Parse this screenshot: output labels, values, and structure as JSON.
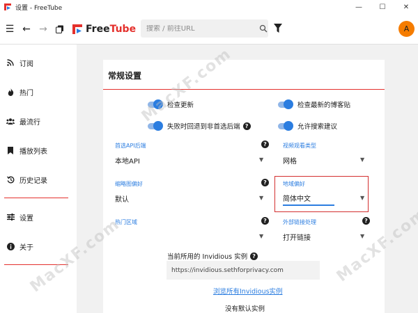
{
  "window": {
    "title": "设置 - FreeTube",
    "minimize": "—",
    "maximize": "☐",
    "close": "✕"
  },
  "topnav": {
    "brand_free": "Free",
    "brand_tube": "Tube",
    "search_placeholder": "搜索 / 前往URL",
    "avatar_letter": "A"
  },
  "sidebar": {
    "items": [
      {
        "label": "订阅",
        "icon": "rss-icon"
      },
      {
        "label": "热门",
        "icon": "fire-icon"
      },
      {
        "label": "最流行",
        "icon": "users-icon"
      },
      {
        "label": "播放列表",
        "icon": "bookmark-icon"
      },
      {
        "label": "历史记录",
        "icon": "history-icon"
      },
      {
        "label": "设置",
        "icon": "sliders-icon"
      },
      {
        "label": "关于",
        "icon": "info-icon"
      }
    ]
  },
  "settings": {
    "section_title": "常规设置",
    "toggles": {
      "check_updates": "检查更新",
      "check_blog": "检查最新的博客贴",
      "fallback_api": "失败时回退到非首选后端",
      "search_suggestions": "允许搜索建议"
    },
    "fields": {
      "preferred_api": {
        "label": "首选API后端",
        "value": "本地API"
      },
      "video_view_type": {
        "label": "视频观看类型",
        "value": "网格"
      },
      "thumbnail_pref": {
        "label": "缩略图偏好",
        "value": "默认"
      },
      "region_pref": {
        "label": "地域偏好",
        "value": "简体中文"
      },
      "trending_region": {
        "label": "热门区域",
        "value": ""
      },
      "external_link": {
        "label": "外部链接处理",
        "value": "打开链接"
      }
    },
    "invidious": {
      "label": "当前所用的 Invidious 实例",
      "value": "https://invidious.sethforprivacy.com",
      "link": "浏览所有Invidious实例",
      "no_default": "没有默认实例"
    }
  },
  "watermark": "MacXF.com",
  "colors": {
    "accent_red": "#e4302c",
    "accent_blue": "#2b7de0",
    "avatar": "#f57c00"
  }
}
